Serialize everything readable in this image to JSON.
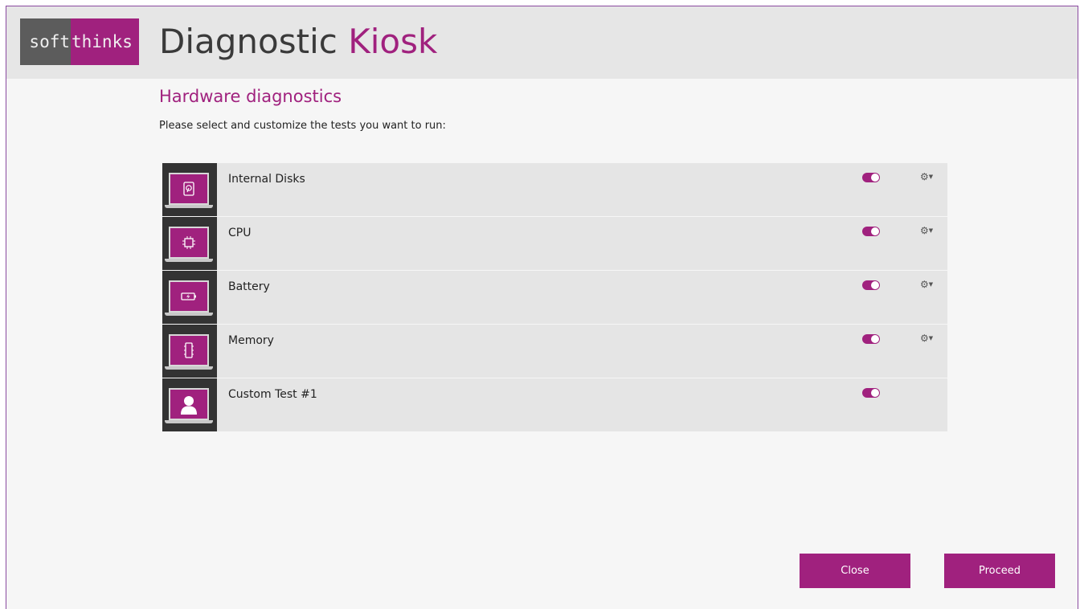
{
  "header": {
    "logo_soft": "soft",
    "logo_thinks": "thinks",
    "title_main": "Diagnostic ",
    "title_accent": "Kiosk"
  },
  "main": {
    "section_title": "Hardware diagnostics",
    "instruction": "Please select and customize the tests you want to run:"
  },
  "tests": [
    {
      "name": "Internal Disks",
      "icon": "disk-icon",
      "enabled": true,
      "has_settings": true
    },
    {
      "name": "CPU",
      "icon": "cpu-icon",
      "enabled": true,
      "has_settings": true
    },
    {
      "name": "Battery",
      "icon": "battery-icon",
      "enabled": true,
      "has_settings": true
    },
    {
      "name": "Memory",
      "icon": "memory-icon",
      "enabled": true,
      "has_settings": true
    },
    {
      "name": "Custom Test #1",
      "icon": "user-icon",
      "enabled": true,
      "has_settings": false
    }
  ],
  "actions": {
    "close_label": "Close",
    "proceed_label": "Proceed"
  },
  "colors": {
    "accent": "#a0217e",
    "header_bg": "#e6e6e6",
    "row_bg": "#e5e5e5"
  }
}
